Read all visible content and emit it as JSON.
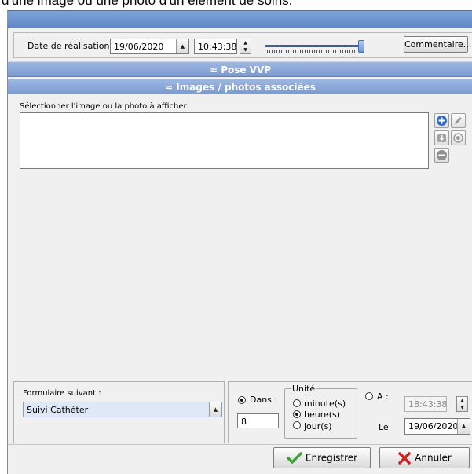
{
  "caption": "d'une image ou une photo d'un élément de soins.",
  "colors": {
    "titlebar": "#6f95cf",
    "section_bar": "#8aa7d8",
    "accent_blue": "#2d6bc4",
    "ok_green": "#3aa335",
    "cancel_red": "#d22020"
  },
  "header": {
    "date_label": "Date de réalisation :",
    "date_value": "19/06/2020",
    "time_value": "10:43:38",
    "comment_button": "Commentaire...",
    "slider_level": 1.0
  },
  "sections": {
    "pose": "Pose VVP",
    "images": "Images / photos associées"
  },
  "images": {
    "select_label": "Sélectionner l'image ou la photo à afficher",
    "icons": [
      "add-icon",
      "pencil-icon",
      "import-icon",
      "view-icon",
      "remove-icon"
    ]
  },
  "next_form": {
    "label": "Formulaire suivant :",
    "selected": "Suivi Cathéter"
  },
  "schedule": {
    "dans_label": "Dans :",
    "dans_value": "8",
    "unit_legend": "Unité",
    "units": [
      "minute(s)",
      "heure(s)",
      "jour(s)"
    ],
    "selected_unit": "heure(s)",
    "a_label": "A :",
    "a_time": "18:43:38",
    "le_label": "Le",
    "le_date": "19/06/2020"
  },
  "footer": {
    "save": "Enregistrer",
    "cancel": "Annuler"
  }
}
